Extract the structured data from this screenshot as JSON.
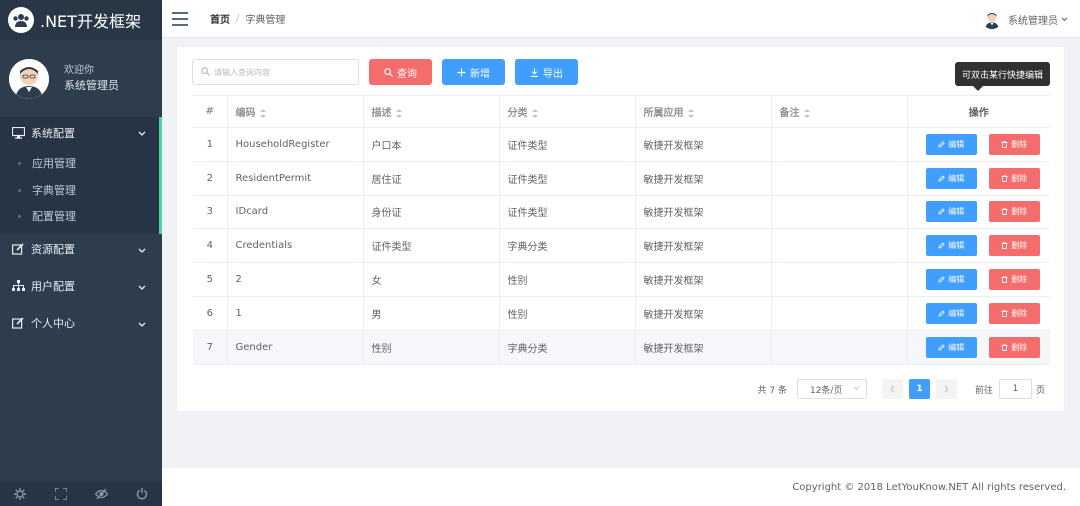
{
  "app": {
    "title": ".NET开发框架"
  },
  "user": {
    "welcome": "欢迎你",
    "name": "系统管理员"
  },
  "sidebar": {
    "groups": [
      {
        "label": "系统配置",
        "icon": "monitor-icon",
        "items": [
          "应用管理",
          "字典管理",
          "配置管理"
        ]
      },
      {
        "label": "资源配置",
        "icon": "edit-icon"
      },
      {
        "label": "用户配置",
        "icon": "sitemap-icon"
      },
      {
        "label": "个人中心",
        "icon": "edit-icon"
      }
    ]
  },
  "header": {
    "home": "首页",
    "current": "字典管理",
    "user_name": "系统管理员"
  },
  "toolbar": {
    "search_placeholder": "请输入查询内容",
    "search_label": "查询",
    "add_label": "新增",
    "export_label": "导出",
    "tooltip": "可双击某行快捷编辑"
  },
  "table": {
    "columns": [
      "#",
      "编码",
      "描述",
      "分类",
      "所属应用",
      "备注",
      "操作"
    ],
    "rows": [
      [
        "1",
        "HouseholdRegister",
        "户口本",
        "证件类型",
        "敏捷开发框架",
        ""
      ],
      [
        "2",
        "ResidentPermit",
        "居住证",
        "证件类型",
        "敏捷开发框架",
        ""
      ],
      [
        "3",
        "IDcard",
        "身份证",
        "证件类型",
        "敏捷开发框架",
        ""
      ],
      [
        "4",
        "Credentials",
        "证件类型",
        "字典分类",
        "敏捷开发框架",
        ""
      ],
      [
        "5",
        "2",
        "女",
        "性别",
        "敏捷开发框架",
        ""
      ],
      [
        "6",
        "1",
        "男",
        "性别",
        "敏捷开发框架",
        ""
      ],
      [
        "7",
        "Gender",
        "性别",
        "字典分类",
        "敏捷开发框架",
        ""
      ]
    ],
    "edit_label": "编辑",
    "delete_label": "删除"
  },
  "pagination": {
    "total": "共 7 条",
    "page_size": "12条/页",
    "current_page": "1",
    "goto_label": "前往",
    "goto_value": "1",
    "page_unit": "页"
  },
  "footer": {
    "copyright": "Copyright © 2018 LetYouKnow.NET All rights reserved."
  },
  "colors": {
    "primary": "#409eff",
    "danger": "#f56c6c",
    "sidebar": "#2e3d4e",
    "active_bar": "#4ad4a7"
  }
}
